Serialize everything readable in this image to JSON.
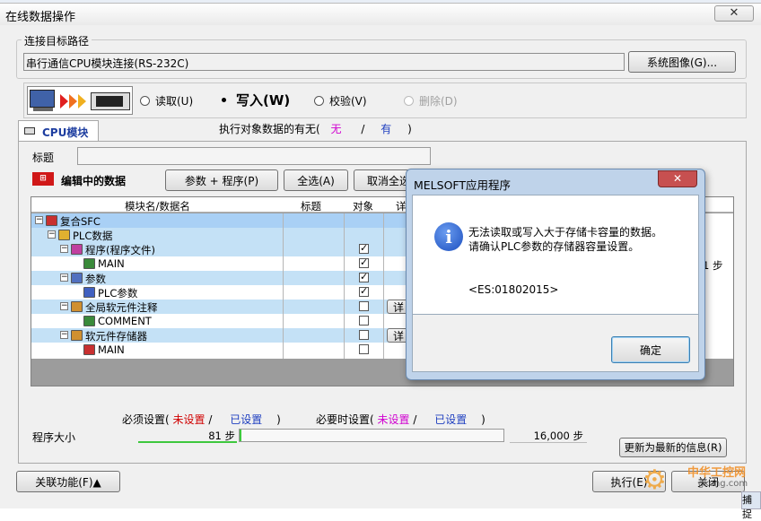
{
  "window": {
    "title": "在线数据操作"
  },
  "connection": {
    "group_label": "连接目标路径",
    "path_value": "串行通信CPU模块连接(RS-232C)",
    "system_image_button": "系统图像(G)..."
  },
  "mode": {
    "read": "读取(U)",
    "write": "写入(W)",
    "verify": "校验(V)",
    "delete": "删除(D)",
    "selected": "write"
  },
  "tab": {
    "label": "CPU模块",
    "exist_label": "执行对象数据的有无(",
    "exist_none": "无",
    "exist_sep": "/",
    "exist_yes": "有",
    "exist_close": ")"
  },
  "title_field": {
    "label": "标题",
    "value": ""
  },
  "editing": {
    "label": "编辑中的数据",
    "param_program_button": "参数 + 程序(P)",
    "select_all_button": "全选(A)",
    "deselect_all_button": "取消全选"
  },
  "table": {
    "headers": {
      "name": "模块名/数据名",
      "title": "标题",
      "target": "对象",
      "detail": "详"
    },
    "rows": [
      {
        "label": "复合SFC",
        "indent": 0,
        "style": "blue2",
        "checked": null,
        "detail": false
      },
      {
        "label": "PLC数据",
        "indent": 1,
        "style": "blue",
        "checked": null,
        "detail": false
      },
      {
        "label": "程序(程序文件)",
        "indent": 2,
        "style": "blue",
        "checked": true,
        "detail": false
      },
      {
        "label": "MAIN",
        "indent": 3,
        "style": "",
        "checked": true,
        "detail": false
      },
      {
        "label": "参数",
        "indent": 2,
        "style": "blue",
        "checked": true,
        "detail": false
      },
      {
        "label": "PLC参数",
        "indent": 3,
        "style": "",
        "checked": true,
        "detail": false
      },
      {
        "label": "全局软元件注释",
        "indent": 2,
        "style": "blue",
        "checked": false,
        "detail": true
      },
      {
        "label": "COMMENT",
        "indent": 3,
        "style": "",
        "checked": false,
        "detail": false
      },
      {
        "label": "软元件存储器",
        "indent": 2,
        "style": "blue",
        "checked": false,
        "detail": true
      },
      {
        "label": "MAIN",
        "indent": 3,
        "style": "",
        "checked": false,
        "detail": false
      }
    ],
    "detail_button": "详",
    "right_value": "1 步"
  },
  "settings": {
    "required_label": "必须设置(",
    "required_unset": "未设置",
    "required_sep": "/",
    "required_set": "已设置",
    "required_close": ")",
    "optional_label": "必要时设置(",
    "optional_unset": "未设置",
    "optional_sep": "/",
    "optional_set": "已设置",
    "optional_close": ")"
  },
  "program_size": {
    "label": "程序大小",
    "used": "81 步",
    "total": "16,000 步",
    "progress_fraction": 0.005
  },
  "buttons": {
    "refresh": "更新为最新的信息(R)",
    "related": "关联功能(F)▲",
    "execute": "执行(E)",
    "close": "关闭"
  },
  "status": {
    "capture": "捕捉"
  },
  "watermark": {
    "text": "中华工控网",
    "sub": "gkong.com"
  },
  "dialog": {
    "title": "MELSOFT应用程序",
    "message_line1": "无法读取或写入大于存储卡容量的数据。",
    "message_line2": "请确认PLC参数的存储器容量设置。",
    "code": "<ES:01802015>",
    "ok_button": "确定",
    "close_glyph": "✕"
  },
  "colors": {
    "pink": "#d000d0",
    "blue_text": "#2040c0",
    "red_text": "#d00000",
    "row_blue": "#c4e1f6",
    "progress_green": "#3ec83e",
    "dialog_close": "#c75050"
  }
}
